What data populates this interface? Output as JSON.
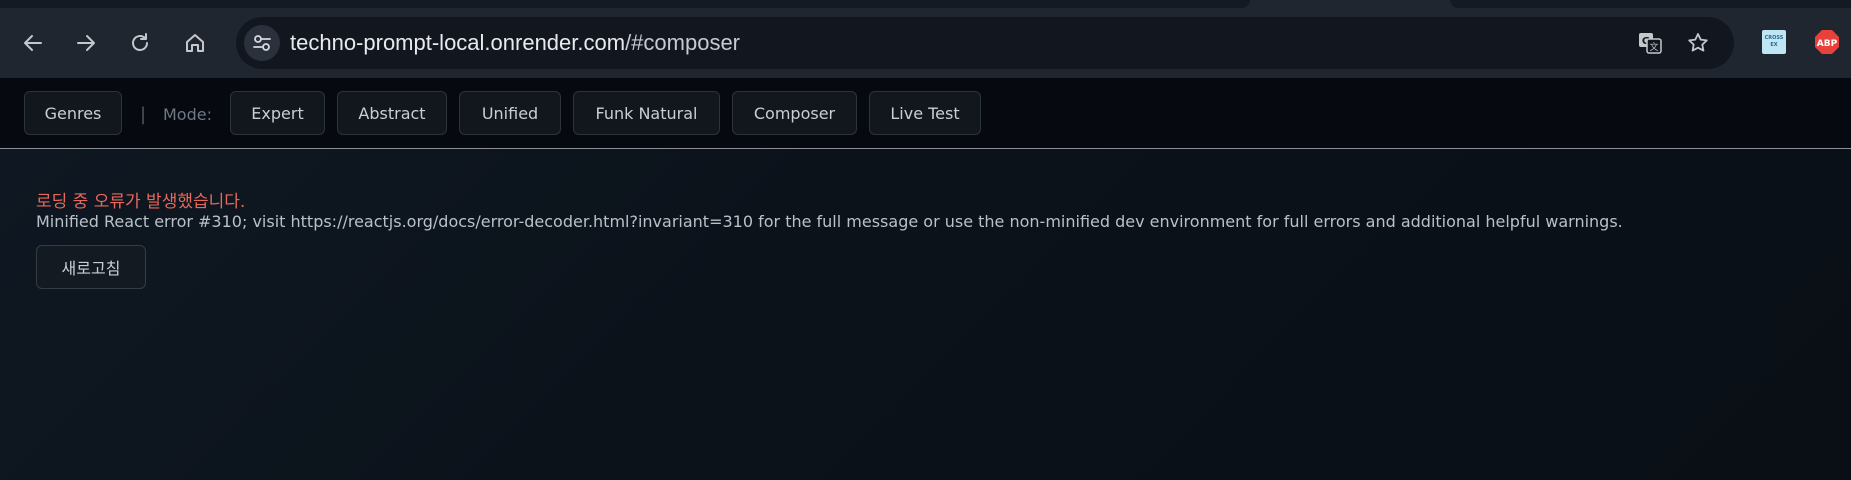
{
  "browser": {
    "url_domain": "techno-prompt-local.onrender.com",
    "url_path": "/#composer",
    "nav_icons": [
      "back-arrow-icon",
      "forward-arrow-icon",
      "reload-icon",
      "home-icon"
    ],
    "omnibox_icons": [
      "site-info-icon",
      "translate-icon",
      "bookmark-star-icon"
    ],
    "extensions": {
      "crossex_line1": "CROSS",
      "crossex_line2": "EX",
      "abp_label": "ABP",
      "abp_color": "#e8413c"
    }
  },
  "toolbar": {
    "genres_label": "Genres",
    "separator": "|",
    "mode_label": "Mode:",
    "modes": [
      "Expert",
      "Abstract",
      "Unified",
      "Funk Natural",
      "Composer",
      "Live Test"
    ]
  },
  "error": {
    "title": "로딩 중 오류가 발생했습니다.",
    "message": "Minified React error #310; visit https://reactjs.org/docs/error-decoder.html?invariant=310 for the full message or use the non-minified dev environment for full errors and additional helpful warnings.",
    "refresh_label": "새로고침",
    "title_color": "#e8685b"
  }
}
